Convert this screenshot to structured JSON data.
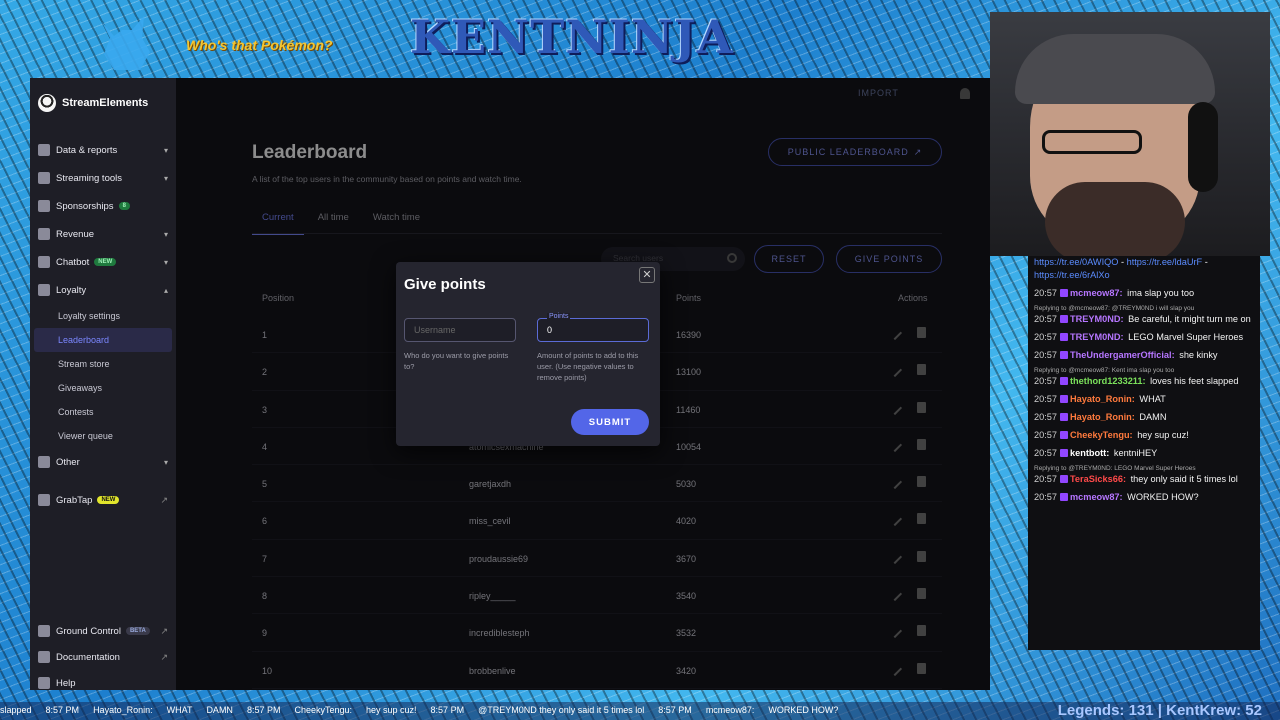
{
  "overlay": {
    "title": "KENTNINJA",
    "whos_that": "Who's that Pokémon?"
  },
  "app": {
    "brand": "StreamElements",
    "nav": [
      {
        "label": "Data & reports",
        "has_chev": true
      },
      {
        "label": "Streaming tools",
        "has_chev": true
      },
      {
        "label": "Sponsorships",
        "badge": "8"
      },
      {
        "label": "Revenue",
        "has_chev": true
      },
      {
        "label": "Chatbot",
        "badge": "NEW",
        "has_chev": true
      },
      {
        "label": "Loyalty",
        "has_chev": true
      }
    ],
    "loyalty_sub": [
      "Loyalty settings",
      "Leaderboard",
      "Stream store",
      "Giveaways",
      "Contests",
      "Viewer queue"
    ],
    "other": "Other",
    "grabtap": "GrabTap",
    "grabtap_badge": "NEW",
    "bottom_nav": [
      {
        "label": "Ground Control",
        "badge": "BETA"
      },
      {
        "label": "Documentation"
      },
      {
        "label": "Help"
      }
    ],
    "import": "IMPORT"
  },
  "leaderboard": {
    "title": "Leaderboard",
    "subtitle": "A list of the top users in the community based on points and watch time.",
    "public_button": "PUBLIC LEADERBOARD",
    "tabs": [
      "Current",
      "All time",
      "Watch time"
    ],
    "search_placeholder": "Search users",
    "reset": "RESET",
    "give_points": "GIVE POINTS",
    "headers": {
      "position": "Position",
      "points": "Points",
      "actions": "Actions"
    },
    "rows": [
      {
        "pos": "1",
        "user": "",
        "points": "16390"
      },
      {
        "pos": "2",
        "user": "",
        "points": "13100"
      },
      {
        "pos": "3",
        "user": "",
        "points": "11460"
      },
      {
        "pos": "4",
        "user": "atomicsexmachine",
        "points": "10054"
      },
      {
        "pos": "5",
        "user": "garetjaxdh",
        "points": "5030"
      },
      {
        "pos": "6",
        "user": "miss_cevil",
        "points": "4020"
      },
      {
        "pos": "7",
        "user": "proudaussie69",
        "points": "3670"
      },
      {
        "pos": "8",
        "user": "ripley_____",
        "points": "3540"
      },
      {
        "pos": "9",
        "user": "incrediblesteph",
        "points": "3532"
      },
      {
        "pos": "10",
        "user": "brobbenlive",
        "points": "3420"
      }
    ]
  },
  "modal": {
    "title": "Give points",
    "username_placeholder": "Username",
    "points_label": "Points",
    "points_value": "0",
    "username_hint": "Who do you want to give points to?",
    "points_hint": "Amount of points to add to this user. (Use negative values to remove points)",
    "submit": "SUBMIT"
  },
  "chat": [
    {
      "type": "links",
      "text": "https://tr.ee/0AWIQO",
      "text2": "https://tr.ee/ldaUrF",
      "text3": "https://tr.ee/6rAlXo"
    },
    {
      "time": "20:57",
      "user": "mcmeow87:",
      "color": "#b676ff",
      "msg": "ima slap you too"
    },
    {
      "type": "reply",
      "text": "Replying to @mcmeow87: @TREYM0ND i will slap you"
    },
    {
      "time": "20:57",
      "user": "TREYM0ND:",
      "color": "#b676ff",
      "msg": "Be careful, it might turn me on"
    },
    {
      "time": "20:57",
      "user": "TREYM0ND:",
      "color": "#b676ff",
      "msg": "LEGO Marvel Super Heroes"
    },
    {
      "time": "20:57",
      "user": "TheUndergamerOfficial:",
      "color": "#b676ff",
      "msg": "she kinky"
    },
    {
      "type": "reply",
      "text": "Replying to @mcmeow87: Kent ima slap you too"
    },
    {
      "time": "20:57",
      "user": "thethord1233211:",
      "color": "#7be05b",
      "msg": "loves his feet slapped"
    },
    {
      "time": "20:57",
      "user": "Hayato_Ronin:",
      "color": "#ff7a3d",
      "msg": "WHAT"
    },
    {
      "time": "20:57",
      "user": "Hayato_Ronin:",
      "color": "#ff7a3d",
      "msg": "DAMN"
    },
    {
      "time": "20:57",
      "user": "CheekyTengu:",
      "color": "#ff7a3d",
      "msg": "hey sup cuz!"
    },
    {
      "time": "20:57",
      "user": "kentbott:",
      "color": "#ffffff",
      "msg": "kentniHEY"
    },
    {
      "type": "reply",
      "text": "Replying to @TREYM0ND: LEGO Marvel Super Heroes"
    },
    {
      "time": "20:57",
      "user": "TeraSicks66:",
      "color": "#ff4a4a",
      "msg": "they only said it 5 times lol"
    },
    {
      "time": "20:57",
      "user": "mcmeow87:",
      "color": "#b676ff",
      "msg": "WORKED HOW?"
    }
  ],
  "ticker": {
    "items": [
      "slapped",
      "8:57 PM",
      "Hayato_Ronin:",
      "WHAT",
      "DAMN",
      "8:57 PM",
      "CheekyTengu:",
      "hey sup cuz!",
      "8:57 PM",
      "@TREYM0ND they only said it 5 times lol",
      "8:57 PM",
      "mcmeow87:",
      "WORKED HOW?"
    ],
    "right": "Legends: 131 | KentKrew: 52"
  }
}
